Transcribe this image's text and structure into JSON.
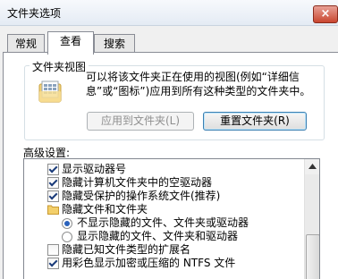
{
  "window": {
    "title": "文件夹选项",
    "close_glyph": "×"
  },
  "tabs": [
    {
      "label": "常规",
      "active": false
    },
    {
      "label": "查看",
      "active": true
    },
    {
      "label": "搜索",
      "active": false
    }
  ],
  "folder_views": {
    "group_label": "文件夹视图",
    "description": "可以将该文件夹正在使用的视图(例如“详细信息”或“图标”)应用到所有这种类型的文件夹中。",
    "apply_button": "应用到文件夹(L)",
    "reset_button": "重置文件夹(R)",
    "icon": "folder-view-icon"
  },
  "advanced": {
    "label": "高级设置:",
    "items": [
      {
        "type": "checkbox",
        "checked": true,
        "label": "显示驱动器号"
      },
      {
        "type": "checkbox",
        "checked": true,
        "label": "隐藏计算机文件夹中的空驱动器"
      },
      {
        "type": "checkbox",
        "checked": true,
        "label": "隐藏受保护的操作系统文件(推荐)"
      },
      {
        "type": "folder",
        "label": "隐藏文件和文件夹",
        "icon": "folder-icon"
      },
      {
        "type": "radio",
        "checked": true,
        "label": "不显示隐藏的文件、文件夹或驱动器"
      },
      {
        "type": "radio",
        "checked": false,
        "label": "显示隐藏的文件、文件夹和驱动器"
      },
      {
        "type": "checkbox",
        "checked": false,
        "label": "隐藏已知文件类型的扩展名"
      },
      {
        "type": "checkbox",
        "checked": true,
        "label": "用彩色显示加密或压缩的 NTFS 文件"
      }
    ]
  }
}
